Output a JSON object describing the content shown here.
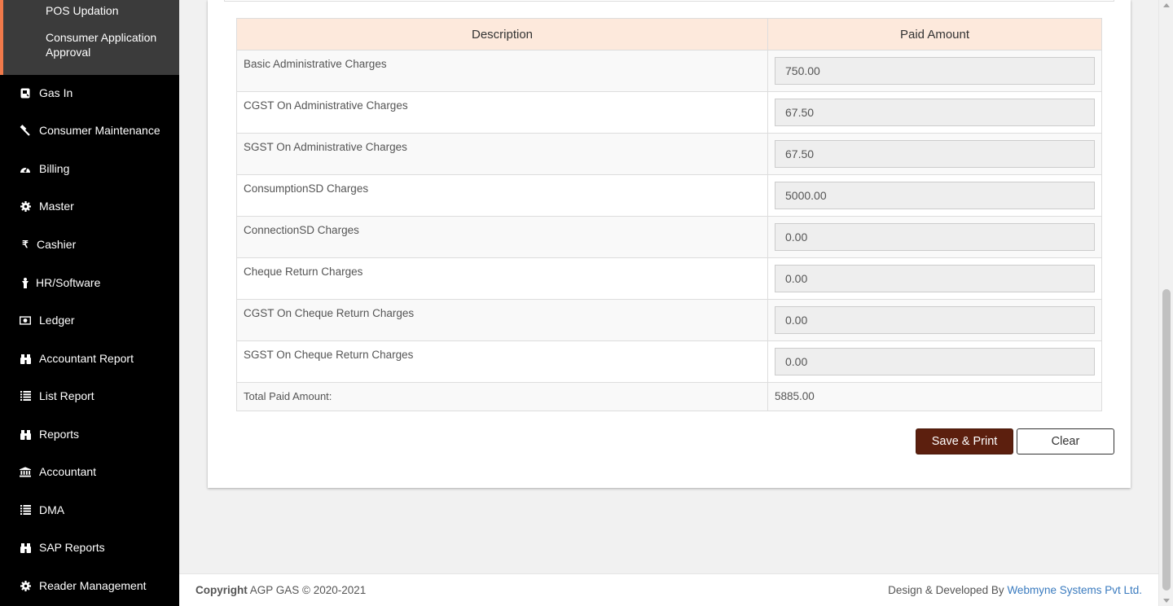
{
  "sidebar": {
    "submenu": [
      {
        "label": "POS Updation"
      },
      {
        "label": "Consumer Application Approval"
      }
    ],
    "items": [
      {
        "label": "Gas In",
        "icon": "gas-icon"
      },
      {
        "label": "Consumer Maintenance",
        "icon": "gavel-icon"
      },
      {
        "label": "Billing",
        "icon": "dashboard-icon"
      },
      {
        "label": "Master",
        "icon": "gear-icon"
      },
      {
        "label": "Cashier",
        "icon": "rupee-icon"
      },
      {
        "label": "HR/Software",
        "icon": "person-icon"
      },
      {
        "label": "Ledger",
        "icon": "money-icon"
      },
      {
        "label": "Accountant Report",
        "icon": "binoculars-icon"
      },
      {
        "label": "List Report",
        "icon": "list-icon"
      },
      {
        "label": "Reports",
        "icon": "binoculars-icon"
      },
      {
        "label": "Accountant",
        "icon": "bank-icon"
      },
      {
        "label": "DMA",
        "icon": "list-icon"
      },
      {
        "label": "SAP Reports",
        "icon": "binoculars-icon"
      },
      {
        "label": "Reader Management",
        "icon": "gear-icon"
      }
    ]
  },
  "table": {
    "headers": {
      "description": "Description",
      "paid_amount": "Paid Amount"
    },
    "rows": [
      {
        "description": "Basic Administrative Charges",
        "amount": "750.00"
      },
      {
        "description": "CGST On Administrative Charges",
        "amount": "67.50"
      },
      {
        "description": "SGST On Administrative Charges",
        "amount": "67.50"
      },
      {
        "description": "ConsumptionSD Charges",
        "amount": "5000.00"
      },
      {
        "description": "ConnectionSD Charges",
        "amount": "0.00"
      },
      {
        "description": "Cheque Return Charges",
        "amount": "0.00"
      },
      {
        "description": "CGST On Cheque Return Charges",
        "amount": "0.00"
      },
      {
        "description": "SGST On Cheque Return Charges",
        "amount": "0.00"
      }
    ],
    "total": {
      "label": "Total Paid Amount:",
      "value": "5885.00"
    }
  },
  "buttons": {
    "save_print": "Save & Print",
    "clear": "Clear"
  },
  "footer": {
    "copyright_bold": "Copyright",
    "copyright_text": "AGP GAS © 2020-2021",
    "developed_prefix": "Design & Developed By",
    "developer": "Webmyne Systems Pvt Ltd."
  },
  "colors": {
    "sidebar_bg": "#000000",
    "submenu_bg": "#3b3b3b",
    "accent": "#f0794a",
    "table_header_bg": "#fde9dc",
    "save_button_bg": "#5c1f0e",
    "link": "#3a7bbf"
  }
}
